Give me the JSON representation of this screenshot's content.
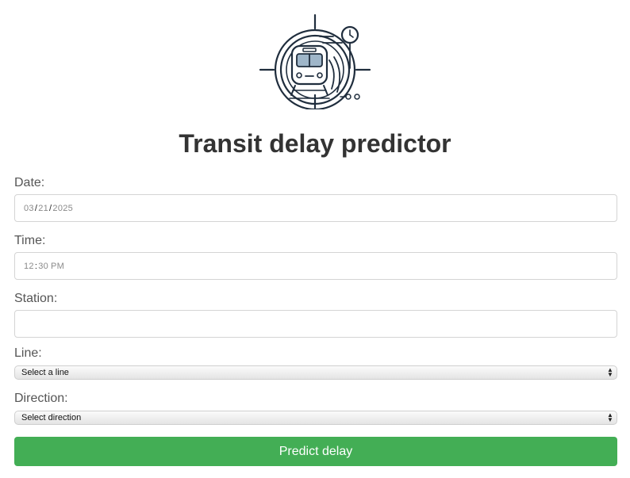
{
  "app": {
    "title": "Transit delay predictor",
    "logo_icon": "train-compass-icon",
    "accent_color": "#43ae55"
  },
  "form": {
    "date": {
      "label": "Date:",
      "month": "03",
      "day": "21",
      "year": "2025"
    },
    "time": {
      "label": "Time:",
      "hour": "12",
      "minute": "30",
      "ampm": "PM"
    },
    "station": {
      "label": "Station:",
      "value": ""
    },
    "line": {
      "label": "Line:",
      "selected": "Select a line"
    },
    "direction": {
      "label": "Direction:",
      "selected": "Select direction"
    },
    "submit_label": "Predict delay"
  }
}
